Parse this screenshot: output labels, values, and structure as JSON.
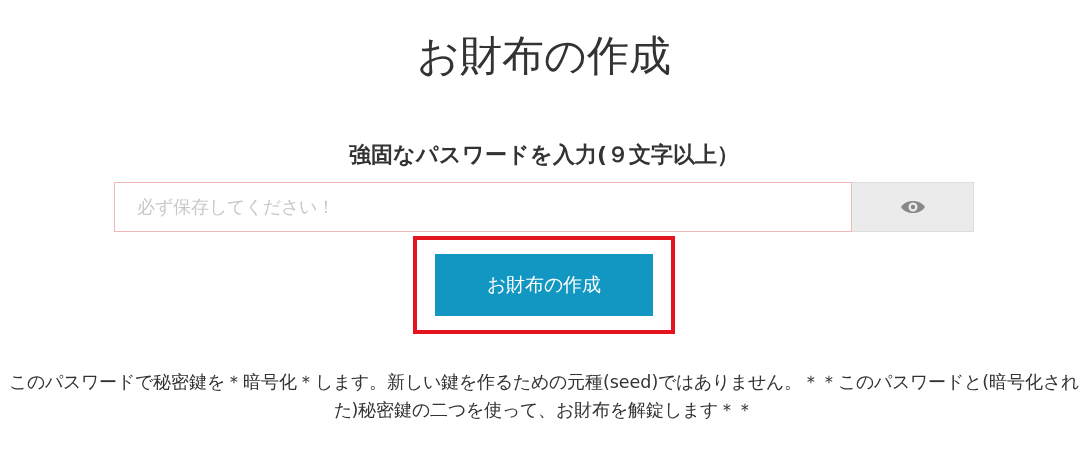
{
  "title": "お財布の作成",
  "password_label": "強固なパスワードを入力(９文字以上）",
  "password_field": {
    "placeholder": "必ず保存してください！"
  },
  "create_button": {
    "label": "お財布の作成",
    "highlighted": true
  },
  "note": "このパスワードで秘密鍵を＊暗号化＊します。新しい鍵を作るための元種(seed)ではありません。＊＊このパスワードと(暗号化された)秘密鍵の二つを使って、お財布を解錠します＊＊"
}
